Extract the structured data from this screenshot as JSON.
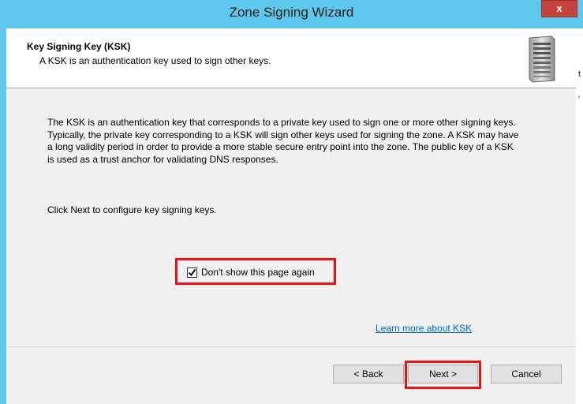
{
  "window": {
    "title": "Zone Signing Wizard",
    "close_label": "x"
  },
  "header": {
    "title": "Key Signing Key (KSK)",
    "subtitle": "A KSK is an authentication key used to sign other keys."
  },
  "body": {
    "description": "The KSK is an authentication key that corresponds to a private key used to sign one or more other signing keys. Typically, the private key corresponding to a KSK will sign other keys used for signing the zone. A KSK may have a long validity period in order to provide a more stable secure entry point into the zone. The public key of a KSK is used as a trust anchor for validating DNS responses.",
    "instruction": "Click Next to configure key signing keys.",
    "checkbox": {
      "label": "Don't show this page again",
      "checked": true
    },
    "learn_more_link": "Learn more about KSK"
  },
  "buttons": {
    "back": "< Back",
    "next": "Next >",
    "cancel": "Cancel"
  },
  "colors": {
    "titlebar": "#5ec8ec",
    "close": "#c7443e",
    "highlight": "#ee1111",
    "link": "#0066cc"
  }
}
